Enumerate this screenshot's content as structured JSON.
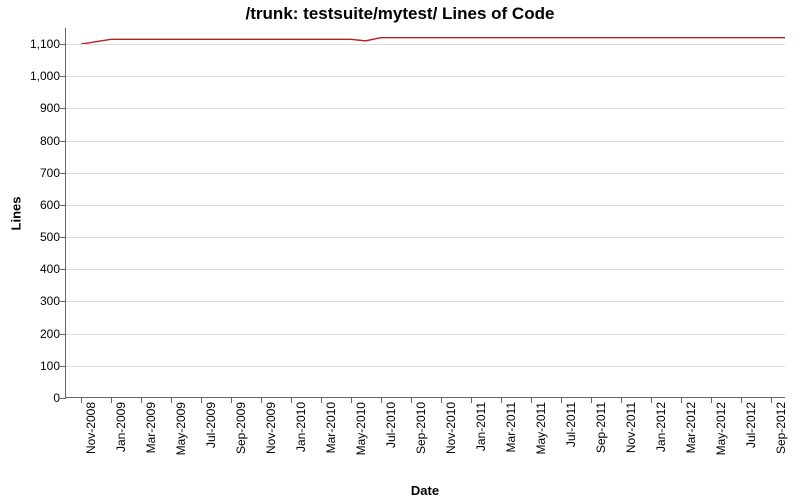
{
  "chart_data": {
    "type": "line",
    "title": "/trunk: testsuite/mytest/ Lines of Code",
    "xlabel": "Date",
    "ylabel": "Lines",
    "ylim": [
      0,
      1150
    ],
    "y_ticks": [
      0,
      100,
      200,
      300,
      400,
      500,
      600,
      700,
      800,
      900,
      1000,
      1100
    ],
    "x_ticks": [
      "Nov-2008",
      "Jan-2009",
      "Mar-2009",
      "May-2009",
      "Jul-2009",
      "Sep-2009",
      "Nov-2009",
      "Jan-2010",
      "Mar-2010",
      "May-2010",
      "Jul-2010",
      "Sep-2010",
      "Nov-2010",
      "Jan-2011",
      "Mar-2011",
      "May-2011",
      "Jul-2011",
      "Sep-2011",
      "Nov-2011",
      "Jan-2012",
      "Mar-2012",
      "May-2012",
      "Jul-2012",
      "Sep-2012"
    ],
    "series": [
      {
        "name": "Lines of Code",
        "color": "#b22222",
        "x": [
          "Nov-2008",
          "Jan-2009",
          "Mar-2009",
          "May-2009",
          "Jul-2009",
          "Sep-2009",
          "Nov-2009",
          "Jan-2010",
          "Mar-2010",
          "May-2010",
          "Jun-2010",
          "Jul-2010",
          "Sep-2010",
          "Nov-2010",
          "Jan-2011",
          "Mar-2011",
          "May-2011",
          "Jul-2011",
          "Sep-2011",
          "Nov-2011",
          "Jan-2012",
          "Mar-2012",
          "May-2012",
          "Jul-2012",
          "Sep-2012",
          "Oct-2012"
        ],
        "values": [
          1100,
          1115,
          1115,
          1115,
          1115,
          1115,
          1115,
          1115,
          1115,
          1115,
          1110,
          1120,
          1120,
          1120,
          1120,
          1120,
          1120,
          1120,
          1120,
          1120,
          1120,
          1120,
          1120,
          1120,
          1120,
          1120
        ]
      }
    ]
  }
}
